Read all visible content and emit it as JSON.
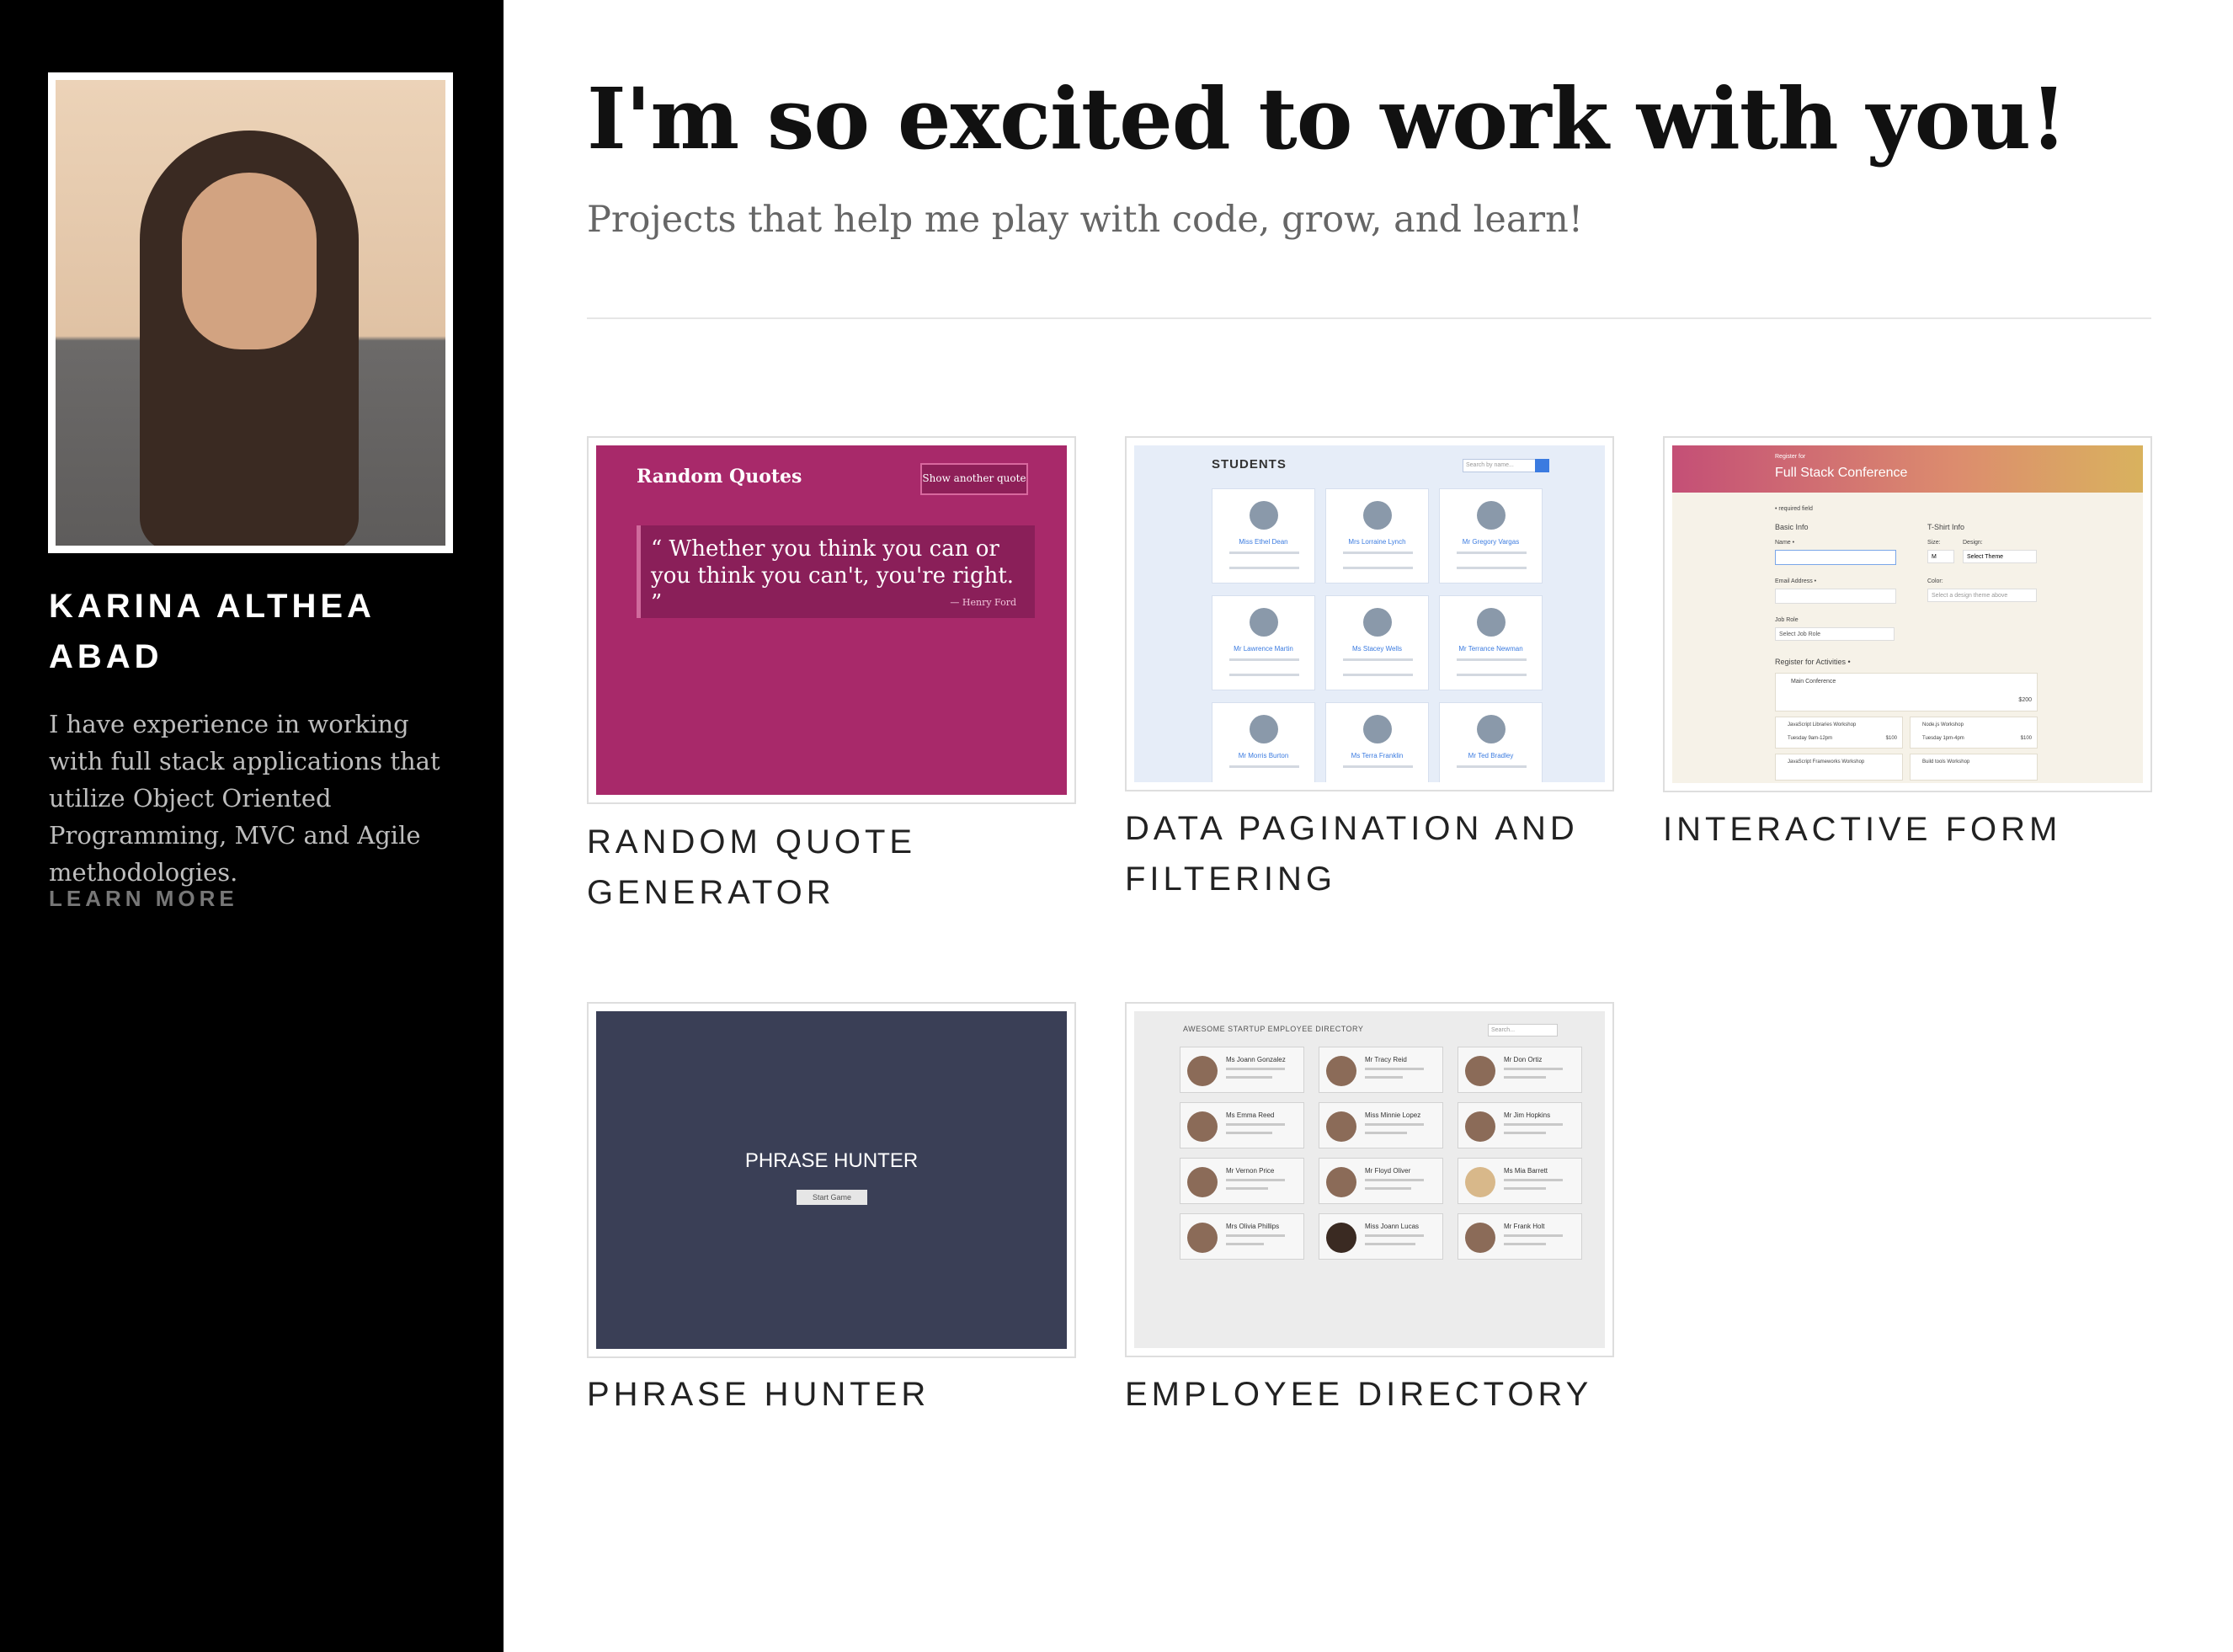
{
  "sidebar": {
    "name": "KARINA ALTHEA ABAD",
    "bio": "I have experience in working with full stack applications that utilize Object Oriented Programming, MVC and Agile methodologies.",
    "learn_more": "LEARN MORE"
  },
  "main": {
    "headline": "I'm so excited to work with you!",
    "subhead": "Projects that help me play with code, grow, and learn!"
  },
  "projects": [
    {
      "title": "RANDOM QUOTE GENERATOR",
      "preview": {
        "title": "Random Quotes",
        "button": "Show another quote",
        "quote": "“ Whether you think you can or you think you can't, you're right. ”",
        "author": "— Henry Ford"
      }
    },
    {
      "title": "DATA PAGINATION AND FILTERING",
      "preview": {
        "heading": "STUDENTS",
        "search_placeholder": "Search by name...",
        "students": [
          "Miss Ethel Dean",
          "Mrs Lorraine Lynch",
          "Mr Gregory Vargas",
          "Mr Lawrence Martin",
          "Ms Stacey Wells",
          "Mr Terrance Newman",
          "Mr Morris Burton",
          "Ms Terra Franklin",
          "Mr Ted Bradley"
        ]
      }
    },
    {
      "title": "INTERACTIVE FORM",
      "preview": {
        "kicker": "Register for",
        "title": "Full Stack Conference",
        "required": "• required field",
        "basic_info": "Basic Info",
        "tshirt_info": "T-Shirt Info",
        "name_label": "Name •",
        "email_label": "Email Address •",
        "job_label": "Job Role",
        "job_value": "Select Job Role",
        "size_label": "Size:",
        "size_value": "M",
        "design_label": "Design:",
        "design_value": "Select Theme",
        "color_label": "Color:",
        "color_value": "Select a design theme above",
        "activities": "Register for Activities •",
        "main_conf": "Main Conference",
        "main_price": "$200",
        "act1": "JavaScript Libraries Workshop",
        "act1_time": "Tuesday 9am-12pm",
        "act1_price": "$100",
        "act2": "Node.js Workshop",
        "act2_time": "Tuesday 1pm-4pm",
        "act2_price": "$100",
        "act3": "JavaScript Frameworks Workshop",
        "act4": "Build tools Workshop"
      }
    },
    {
      "title": "PHRASE HUNTER",
      "preview": {
        "title": "PHRASE HUNTER",
        "button": "Start Game"
      }
    },
    {
      "title": "EMPLOYEE DIRECTORY",
      "preview": {
        "heading": "AWESOME STARTUP EMPLOYEE DIRECTORY",
        "search_placeholder": "Search...",
        "employees": [
          "Ms Joann Gonzalez",
          "Mr Tracy Reid",
          "Mr Don Ortiz",
          "Ms Emma Reed",
          "Miss Minnie Lopez",
          "Mr Jim Hopkins",
          "Mr Vernon Price",
          "Mr Floyd Oliver",
          "Ms Mia Barrett",
          "Mrs Olivia Phillips",
          "Miss Joann Lucas",
          "Mr Frank Holt"
        ]
      }
    }
  ]
}
